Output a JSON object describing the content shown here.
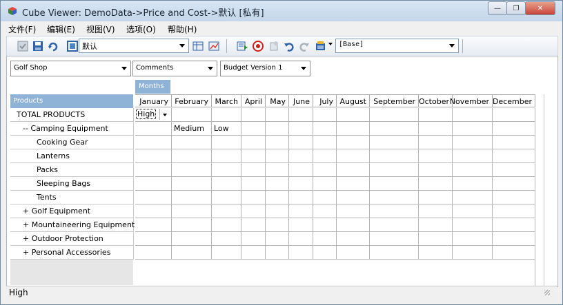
{
  "window": {
    "title": "Cube Viewer: DemoData->Price and Cost->默认  [私有]",
    "minimize": "—",
    "restore": "❐",
    "close": "✕"
  },
  "menu": [
    {
      "label": "文件(F)"
    },
    {
      "label": "编辑(E)"
    },
    {
      "label": "视图(V)"
    },
    {
      "label": "选项(O)"
    },
    {
      "label": "帮助(H)"
    }
  ],
  "toolbar": {
    "view_name": "默认",
    "subset": "[Base]"
  },
  "dimensions": {
    "product_filter": "Golf Shop",
    "measure_filter": "Comments",
    "version_filter": "Budget Version 1",
    "column_dim": "Months",
    "row_dim": "Products"
  },
  "columns": [
    "January",
    "February",
    "March",
    "April",
    "May",
    "June",
    "July",
    "August",
    "September",
    "October",
    "November",
    "December"
  ],
  "rows": [
    {
      "label": "TOTAL PRODUCTS",
      "prefix": ""
    },
    {
      "label": "Camping Equipment",
      "prefix": "-- "
    },
    {
      "label": "Cooking Gear",
      "prefix": ""
    },
    {
      "label": "Lanterns",
      "prefix": ""
    },
    {
      "label": "Packs",
      "prefix": ""
    },
    {
      "label": "Sleeping Bags",
      "prefix": ""
    },
    {
      "label": "Tents",
      "prefix": ""
    },
    {
      "label": "Golf Equipment",
      "prefix": "+ "
    },
    {
      "label": "Mountaineering Equipment",
      "prefix": "+ "
    },
    {
      "label": "Outdoor Protection",
      "prefix": "+ "
    },
    {
      "label": "Personal Accessories",
      "prefix": "+ "
    }
  ],
  "cells": {
    "r0c0": "High",
    "r1c1": "Medium",
    "r1c2": "Low"
  },
  "status": {
    "text": "High"
  },
  "colors": {
    "header_blue": "#8fb2d7",
    "title_gradient": "#c4d6ea"
  }
}
